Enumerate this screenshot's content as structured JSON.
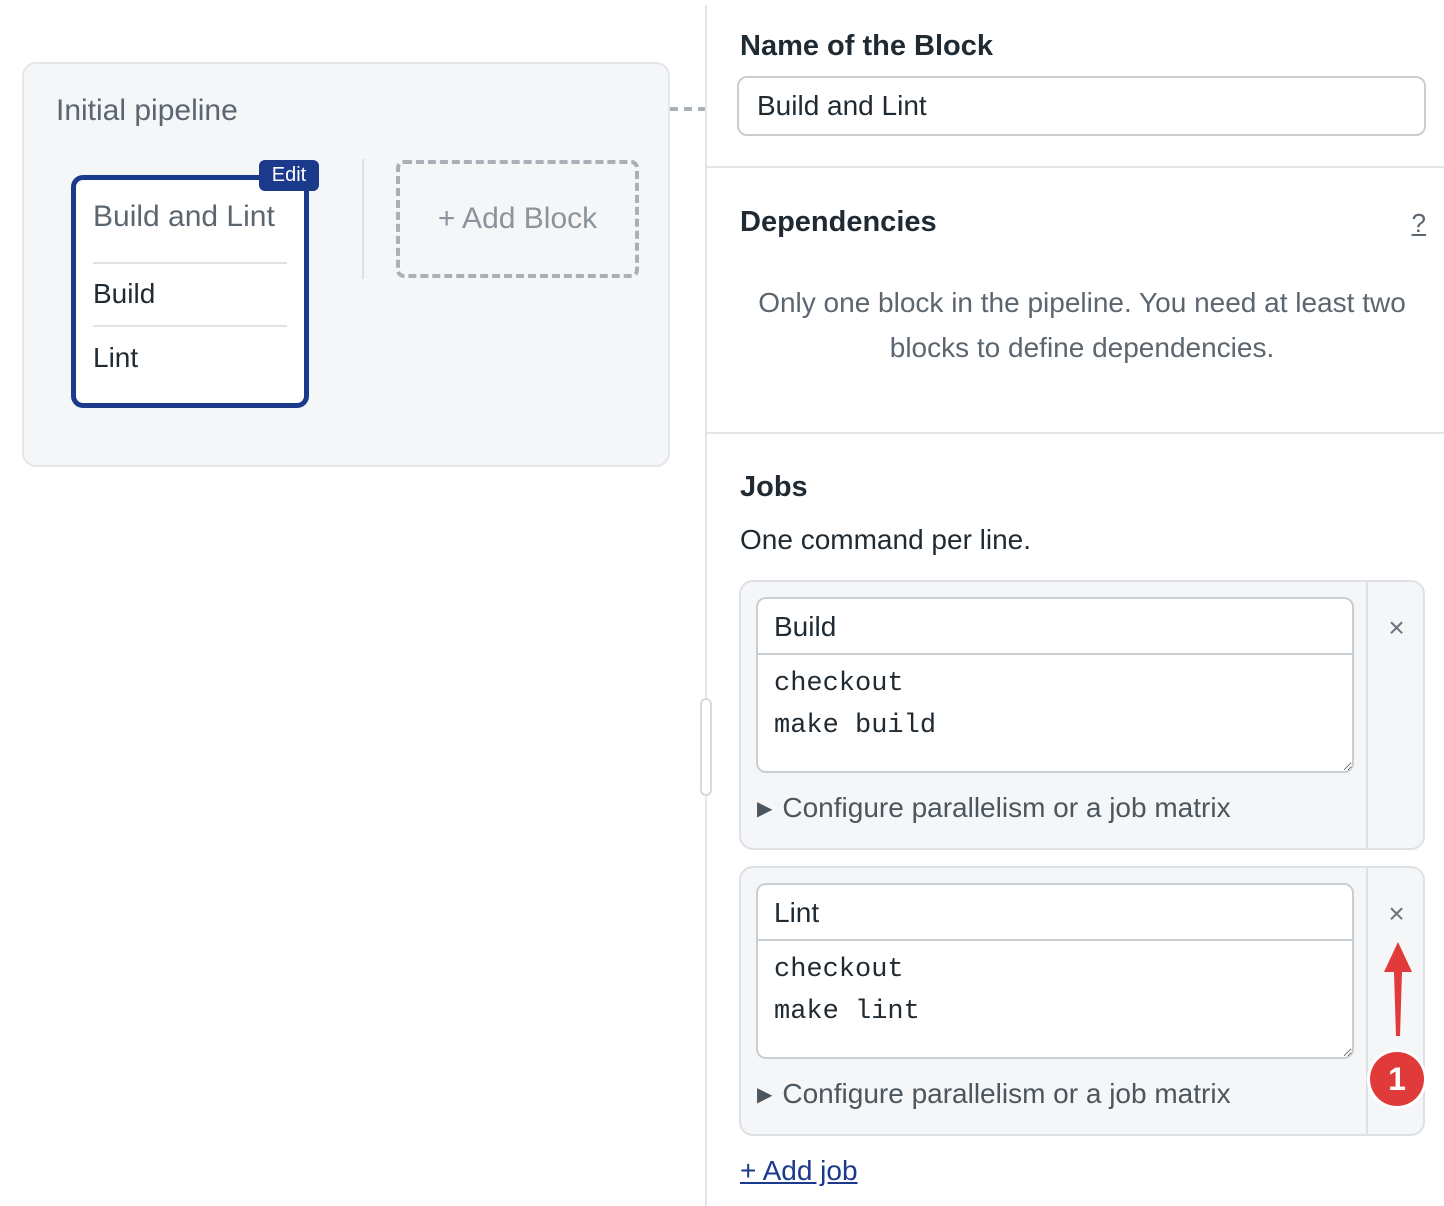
{
  "canvas": {
    "pipeline_title": "Initial pipeline",
    "block": {
      "edit_label": "Edit",
      "title": "Build and Lint",
      "jobs": [
        "Build",
        "Lint"
      ]
    },
    "add_block_label": "+ Add Block"
  },
  "panel": {
    "name_section_title": "Name of the Block",
    "block_name_value": "Build and Lint",
    "dependencies": {
      "title": "Dependencies",
      "help_label": "?",
      "message": "Only one block in the pipeline. You need at least two blocks to define dependencies."
    },
    "jobs": {
      "title": "Jobs",
      "subtitle": "One command per line.",
      "items": [
        {
          "name": "Build",
          "commands": [
            "checkout",
            "make build"
          ],
          "config_label": "Configure parallelism or a job matrix",
          "remove_label": "×"
        },
        {
          "name": "Lint",
          "commands": [
            "checkout",
            "make lint"
          ],
          "config_label": "Configure parallelism or a job matrix",
          "remove_label": "×"
        }
      ],
      "add_job_label": "+ Add job"
    }
  },
  "annotation": {
    "badge_number": "1",
    "color": "#e03a3a"
  },
  "colors": {
    "accent": "#1b3a8c",
    "panel_background": "#f4f6f8"
  }
}
